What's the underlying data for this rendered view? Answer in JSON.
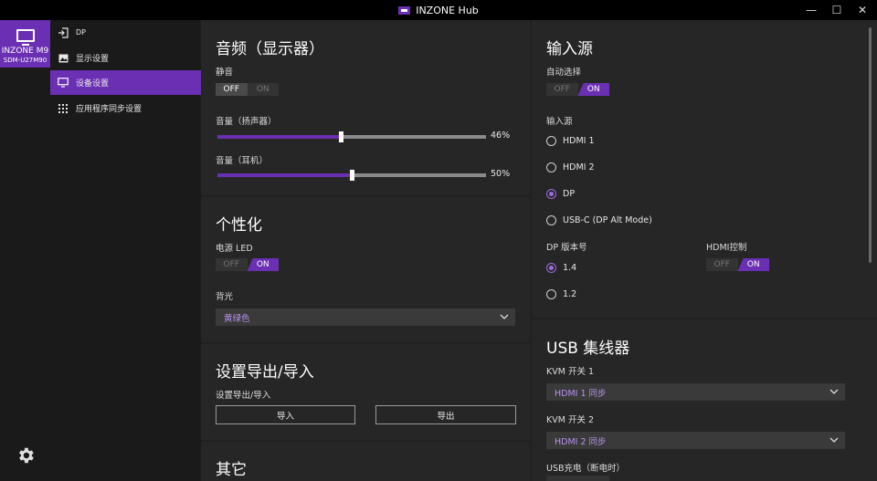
{
  "window": {
    "title": "INZONE Hub",
    "minimize": "—",
    "maximize": "☐",
    "close": "✕"
  },
  "device": {
    "name": "INZONE M9",
    "model": "SDM-U27M90"
  },
  "nav": {
    "items": [
      {
        "label": "DP"
      },
      {
        "label": "显示设置"
      },
      {
        "label": "设备设置"
      },
      {
        "label": "应用程序同步设置"
      }
    ]
  },
  "audio": {
    "title": "音频（显示器）",
    "mute_label": "静音",
    "mute": {
      "off": "OFF",
      "on": "ON",
      "selected": "OFF"
    },
    "speaker_label": "音量（扬声器）",
    "speaker_value": 46,
    "speaker_text": "46%",
    "headphone_label": "音量（耳机）",
    "headphone_value": 50,
    "headphone_text": "50%"
  },
  "personal": {
    "title": "个性化",
    "led_label": "电源 LED",
    "led": {
      "off": "OFF",
      "on": "ON",
      "selected": "ON"
    },
    "backlight_label": "背光",
    "backlight_value": "黄绿色"
  },
  "export": {
    "title": "设置导出/导入",
    "label": "设置导出/导入",
    "import": "导入",
    "export": "导出"
  },
  "other": {
    "title": "其它"
  },
  "input": {
    "title": "输入源",
    "auto_label": "自动选择",
    "auto": {
      "off": "OFF",
      "on": "ON",
      "selected": "ON"
    },
    "source_label": "输入源",
    "sources": [
      "HDMI 1",
      "HDMI 2",
      "DP",
      "USB-C (DP Alt Mode)"
    ],
    "selected_source": "DP",
    "dp_version_label": "DP 版本号",
    "dp_versions": [
      "1.4",
      "1.2"
    ],
    "selected_dp": "1.4",
    "hdmi_ctrl_label": "HDMI控制",
    "hdmi_ctrl": {
      "off": "OFF",
      "on": "ON",
      "selected": "ON"
    }
  },
  "usb": {
    "title": "USB 集线器",
    "kvm1_label": "KVM 开关 1",
    "kvm1_value": "HDMI 1 同步",
    "kvm2_label": "KVM 开关 2",
    "kvm2_value": "HDMI 2 同步",
    "charge_label": "USB充电（断电时）"
  },
  "colors": {
    "accent": "#6b2fb3",
    "accent_text": "#b890f0",
    "panel": "#262626",
    "bg": "#202020"
  }
}
